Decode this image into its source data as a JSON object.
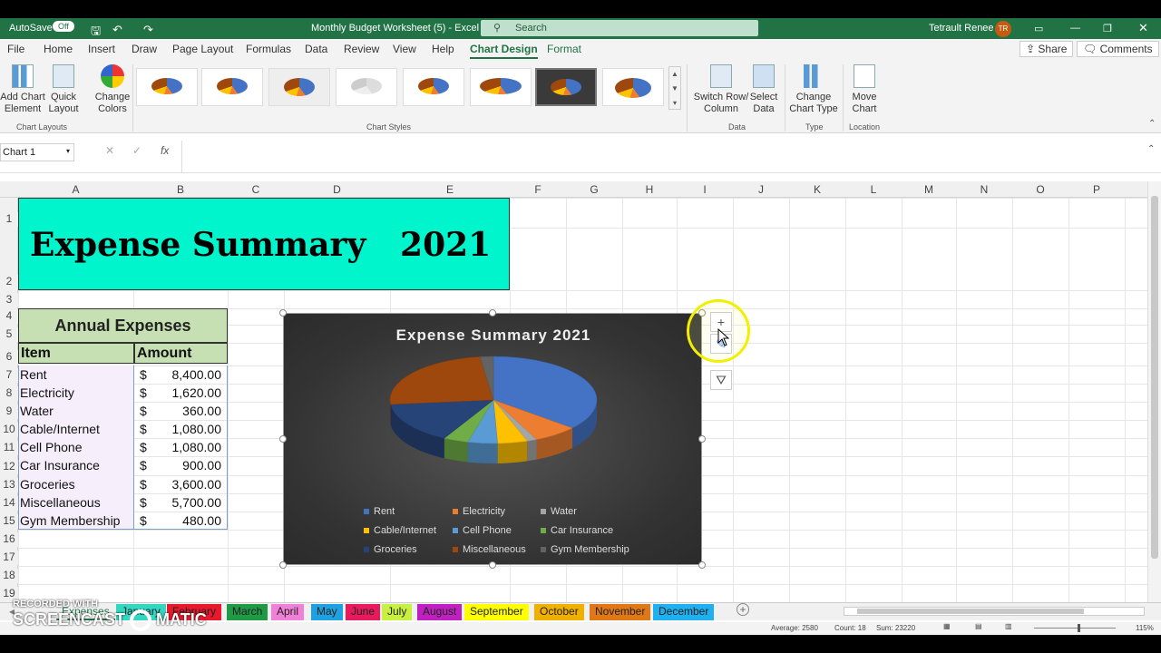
{
  "titlebar": {
    "autosave": "AutoSave",
    "autosave_state": "Off",
    "doc_title": "Monthly Budget Worksheet (5)  -  Excel",
    "search_placeholder": "Search",
    "user": "Tetrault Renee",
    "user_initials": "TR"
  },
  "ribbon_tabs": [
    "File",
    "Home",
    "Insert",
    "Draw",
    "Page Layout",
    "Formulas",
    "Data",
    "Review",
    "View",
    "Help",
    "Chart Design",
    "Format"
  ],
  "share": "Share",
  "comments": "Comments",
  "ribbon": {
    "add_chart_element": [
      "Add Chart",
      "Element"
    ],
    "quick_layout": [
      "Quick",
      "Layout"
    ],
    "change_colors": [
      "Change",
      "Colors"
    ],
    "chart_layouts_label": "Chart Layouts",
    "chart_styles_label": "Chart Styles",
    "switch_row_col": [
      "Switch Row/",
      "Column"
    ],
    "select_data": [
      "Select",
      "Data"
    ],
    "data_label": "Data",
    "change_chart_type": [
      "Change",
      "Chart Type"
    ],
    "type_label": "Type",
    "move_chart": [
      "Move",
      "Chart"
    ],
    "location_label": "Location"
  },
  "formula_bar": {
    "name_box": "Chart 1",
    "fx": "fx"
  },
  "columns": [
    "A",
    "B",
    "C",
    "D",
    "E",
    "F",
    "G",
    "H",
    "I",
    "J",
    "K",
    "L",
    "M",
    "N",
    "O",
    "P"
  ],
  "rows": [
    "1",
    "2",
    "3",
    "4",
    "5",
    "6",
    "7",
    "8",
    "9",
    "10",
    "11",
    "12",
    "13",
    "14",
    "15",
    "16",
    "17",
    "18",
    "19"
  ],
  "sheet_title": "Expense Summary   2021",
  "table": {
    "heading": "Annual Expenses",
    "col_item": "Item",
    "col_amount": "Amount",
    "currency": "$",
    "rows": [
      {
        "item": "Rent",
        "amount": "8,400.00"
      },
      {
        "item": "Electricity",
        "amount": "1,620.00"
      },
      {
        "item": "Water",
        "amount": "360.00"
      },
      {
        "item": "Cable/Internet",
        "amount": "1,080.00"
      },
      {
        "item": "Cell Phone",
        "amount": "1,080.00"
      },
      {
        "item": "Car Insurance",
        "amount": "900.00"
      },
      {
        "item": "Groceries",
        "amount": "3,600.00"
      },
      {
        "item": "Miscellaneous",
        "amount": "5,700.00"
      },
      {
        "item": "Gym Membership",
        "amount": "480.00"
      }
    ]
  },
  "chart_data": {
    "type": "pie",
    "title": "Expense Summary 2021",
    "categories": [
      "Rent",
      "Electricity",
      "Water",
      "Cable/Internet",
      "Cell Phone",
      "Car Insurance",
      "Groceries",
      "Miscellaneous",
      "Gym Membership"
    ],
    "values": [
      8400,
      1620,
      360,
      1080,
      1080,
      900,
      3600,
      5700,
      480
    ],
    "colors": [
      "#4472c4",
      "#ed7d31",
      "#a5a5a5",
      "#ffc000",
      "#5b9bd5",
      "#70ad47",
      "#264478",
      "#9e480e",
      "#636363"
    ],
    "legend_position": "bottom"
  },
  "sheet_tabs": [
    {
      "label": "Expenses",
      "color": "#f0f0f0"
    },
    {
      "label": "January",
      "color": "#33d6c0"
    },
    {
      "label": "February",
      "color": "#e8192c"
    },
    {
      "label": "March",
      "color": "#1f9a45"
    },
    {
      "label": "April",
      "color": "#f080d8"
    },
    {
      "label": "May",
      "color": "#1fa0e0"
    },
    {
      "label": "June",
      "color": "#e8195c"
    },
    {
      "label": "July",
      "color": "#c8f040"
    },
    {
      "label": "August",
      "color": "#c020c0"
    },
    {
      "label": "September",
      "color": "#ffff00"
    },
    {
      "label": "October",
      "color": "#f0b000"
    },
    {
      "label": "November",
      "color": "#e07818"
    },
    {
      "label": "December",
      "color": "#20b0f0"
    }
  ],
  "status": {
    "average": "Average: 2580",
    "count": "Count: 18",
    "sum": "Sum: 23220",
    "zoom": "115%"
  },
  "watermark": {
    "line1": "RECORDED WITH",
    "line2": "SCREENCAST",
    "line3": "MATIC"
  }
}
